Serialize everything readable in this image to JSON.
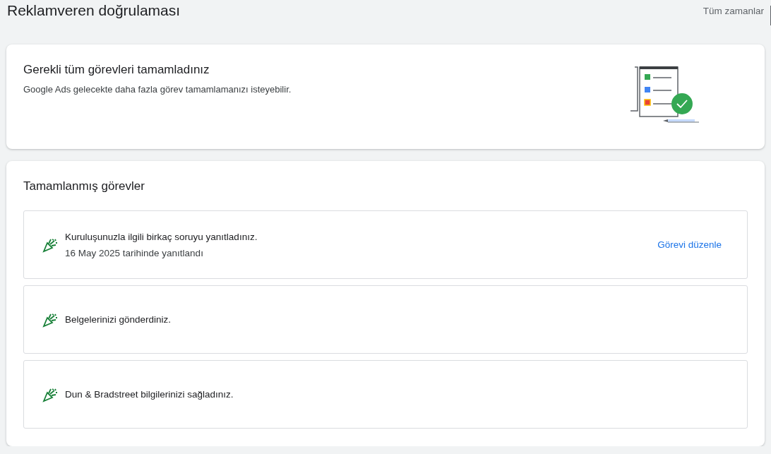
{
  "header": {
    "title": "Reklamveren doğrulaması",
    "date_range": "Tüm zamanlar"
  },
  "status_card": {
    "title": "Gerekli tüm görevleri tamamladınız",
    "description": "Google Ads gelecekte daha fazla görev tamamlamanızı isteyebilir."
  },
  "completed_tasks": {
    "title": "Tamamlanmış görevler",
    "items": [
      {
        "title": "Kuruluşunuzla ilgili birkaç soruyu yanıtladınız.",
        "subtitle": "16 May 2025 tarihinde yanıtlandı",
        "action": "Görevi düzenle"
      },
      {
        "title": "Belgelerinizi gönderdiniz."
      },
      {
        "title": "Dun & Bradstreet bilgilerinizi sağladınız."
      }
    ]
  }
}
